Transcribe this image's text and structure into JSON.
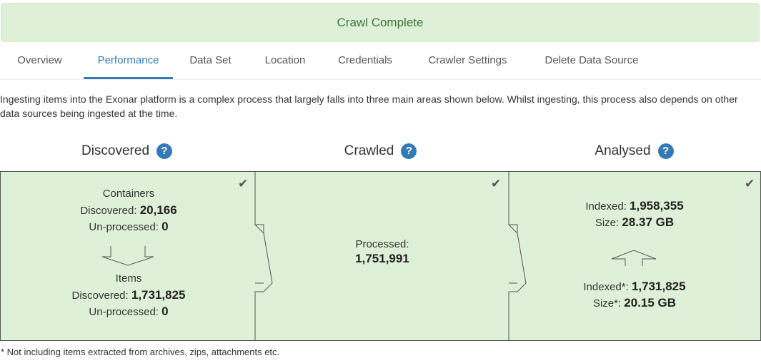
{
  "banner": {
    "text": "Crawl Complete"
  },
  "tabs": [
    {
      "label": "Overview"
    },
    {
      "label": "Performance"
    },
    {
      "label": "Data Set"
    },
    {
      "label": "Location"
    },
    {
      "label": "Credentials"
    },
    {
      "label": "Crawler Settings"
    },
    {
      "label": "Delete Data Source"
    }
  ],
  "active_tab": "Performance",
  "description": "Ingesting items into the Exonar platform is a complex process that largely falls into three main areas shown below. Whilst ingesting, this process also depends on other data sources being ingested at the time.",
  "help_glyph": "?",
  "check_glyph": "✔",
  "discovered": {
    "heading": "Discovered",
    "containers_title": "Containers",
    "containers_discovered_label": "Discovered:",
    "containers_discovered_value": "20,166",
    "containers_unprocessed_label": "Un-processed:",
    "containers_unprocessed_value": "0",
    "items_title": "Items",
    "items_discovered_label": "Discovered:",
    "items_discovered_value": "1,731,825",
    "items_unprocessed_label": "Un-processed:",
    "items_unprocessed_value": "0"
  },
  "crawled": {
    "heading": "Crawled",
    "processed_label": "Processed:",
    "processed_value": "1,751,991"
  },
  "analysed": {
    "heading": "Analysed",
    "indexed_label": "Indexed:",
    "indexed_value": "1,958,355",
    "size_label": "Size:",
    "size_value": "28.37 GB",
    "indexed_star_label": "Indexed*:",
    "indexed_star_value": "1,731,825",
    "size_star_label": "Size*:",
    "size_star_value": "20.15 GB"
  },
  "footnote": "* Not including items extracted from archives, zips, attachments etc.",
  "colors": {
    "success_bg": "#dff0d8",
    "success_text": "#3c763d",
    "link": "#337ab7"
  }
}
